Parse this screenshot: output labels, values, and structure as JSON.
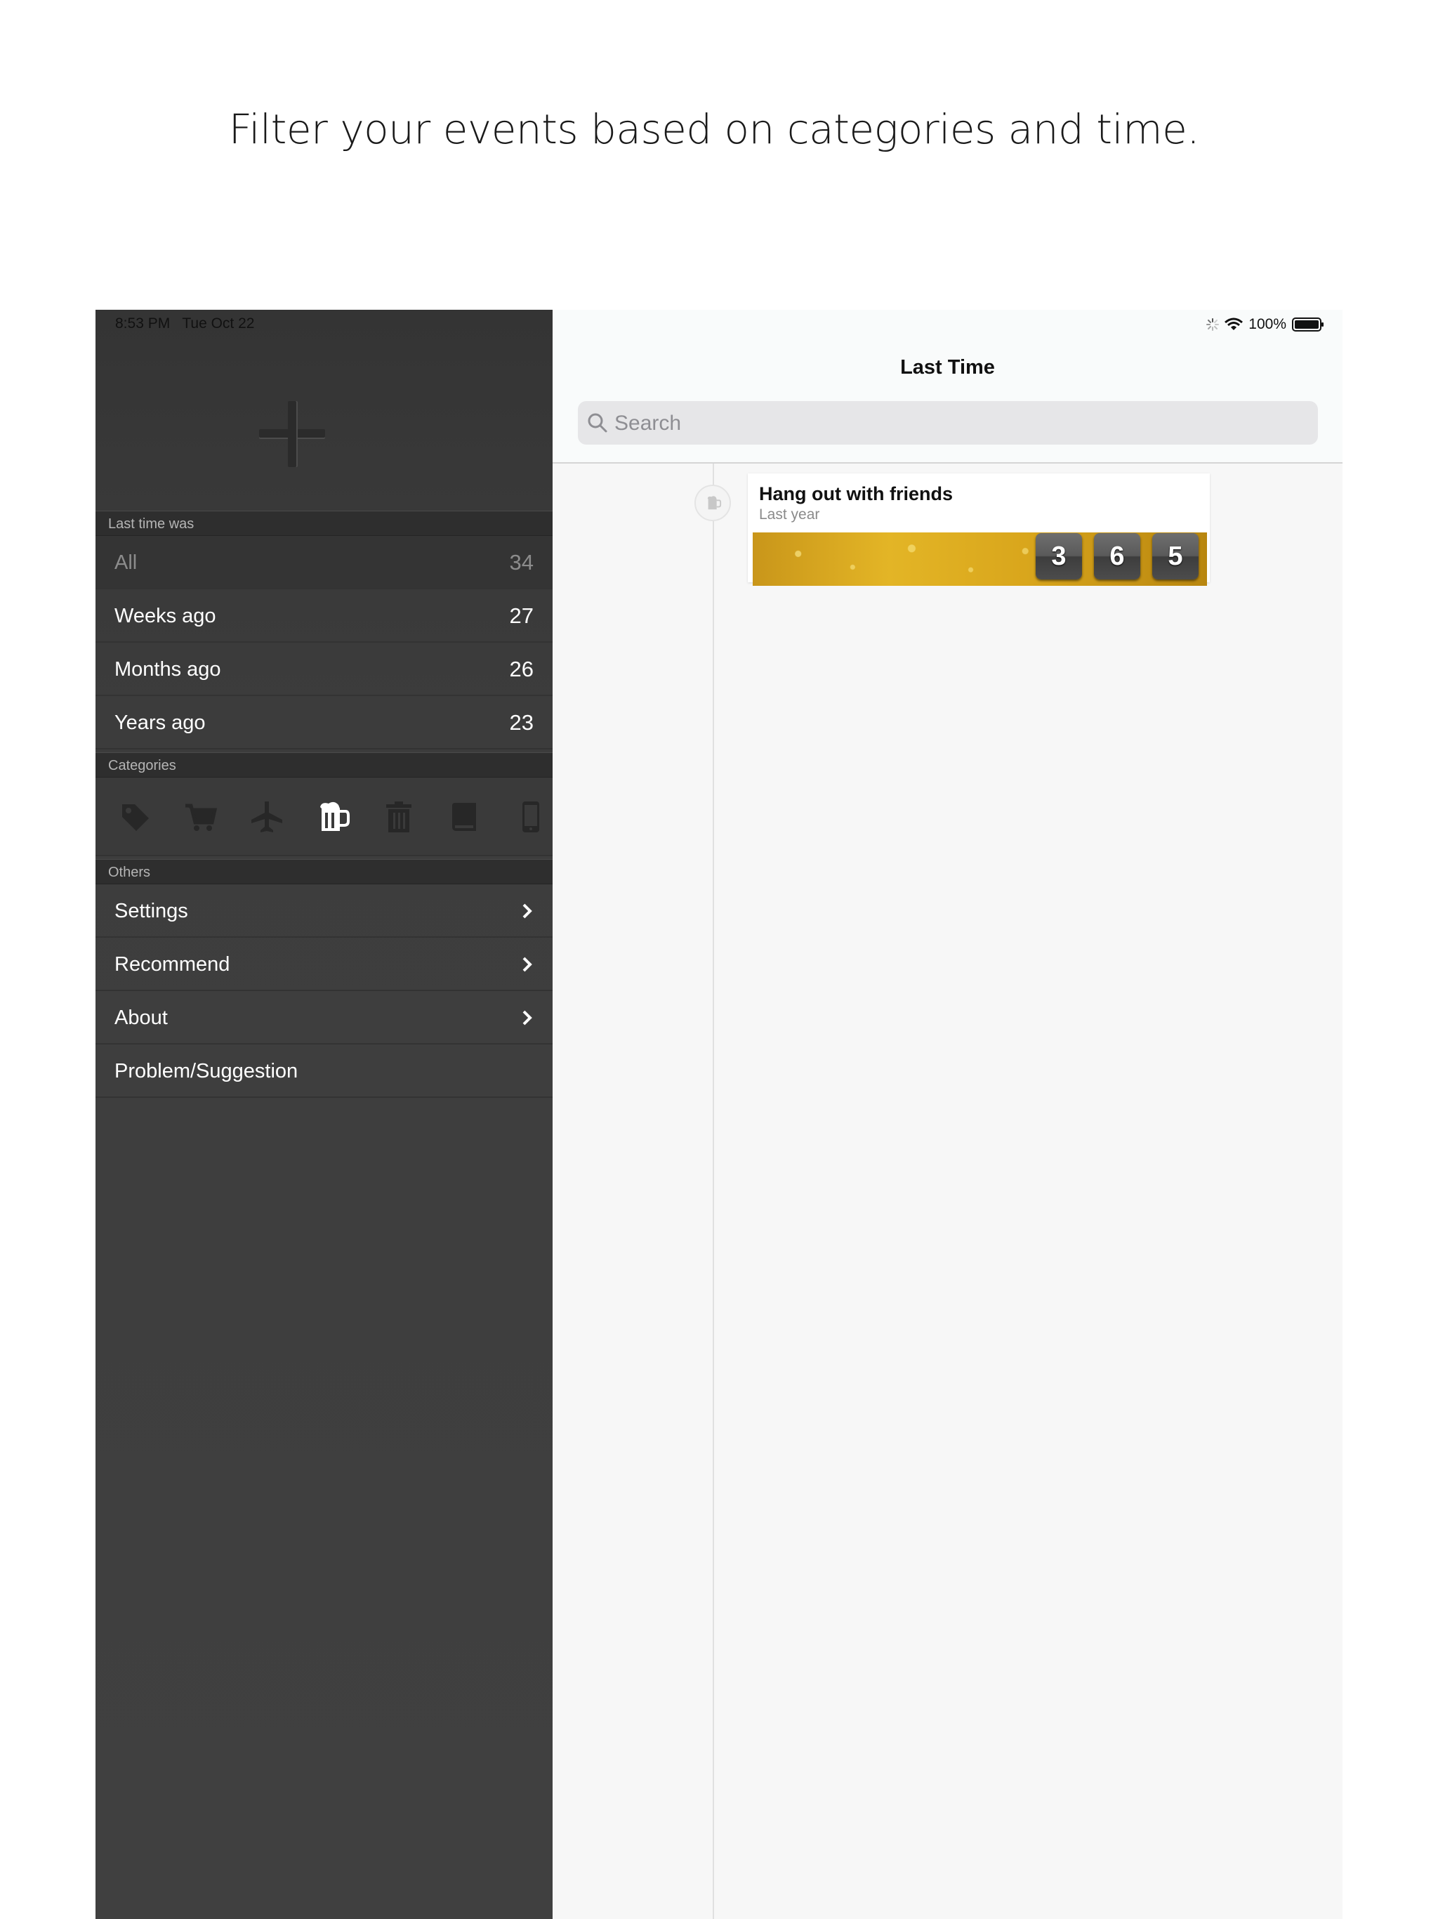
{
  "headline": "Filter your events based on categories and time.",
  "status_bar": {
    "time": "8:53 PM",
    "date": "Tue Oct 22",
    "battery": "100%"
  },
  "sidebar": {
    "section_last_time": "Last time was",
    "filters": [
      {
        "label": "All",
        "count": "34",
        "selected": true
      },
      {
        "label": "Weeks ago",
        "count": "27"
      },
      {
        "label": "Months ago",
        "count": "26"
      },
      {
        "label": "Years ago",
        "count": "23"
      }
    ],
    "section_categories": "Categories",
    "categories": [
      "tag-icon",
      "cart-icon",
      "airplane-icon",
      "beer-mug-icon",
      "trash-icon",
      "book-icon",
      "phone-icon"
    ],
    "selected_category": "beer-mug-icon",
    "section_others": "Others",
    "others": [
      {
        "label": "Settings"
      },
      {
        "label": "Recommend"
      },
      {
        "label": "About"
      },
      {
        "label": "Problem/Suggestion"
      }
    ]
  },
  "main": {
    "title": "Last Time",
    "search_placeholder": "Search",
    "events": [
      {
        "title": "Hang out with friends",
        "subtitle": "Last year",
        "icon": "beer-mug-icon",
        "days_digits": [
          "3",
          "6",
          "5"
        ]
      }
    ]
  },
  "colors": {
    "sidebar_bg": "#3f3f3f",
    "section_header_bg": "#2e2e2e",
    "main_bg": "#f7f7f7",
    "card_image": "#d9a61c"
  }
}
